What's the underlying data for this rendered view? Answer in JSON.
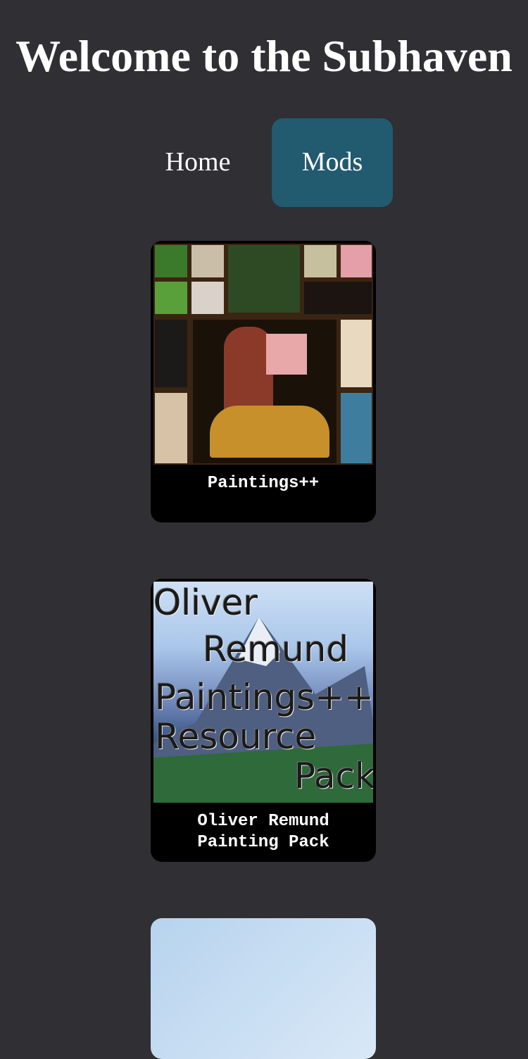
{
  "header": {
    "title": "Welcome to the Subhaven"
  },
  "nav": {
    "home_label": "Home",
    "mods_label": "Mods",
    "active": "Mods"
  },
  "mods": [
    {
      "name": "Paintings++"
    },
    {
      "name": "Oliver Remund Painting Pack",
      "name_line1": "Oliver Remund",
      "name_line2": "Painting Pack",
      "thumbnail_text": [
        "Oliver",
        "Remund",
        "Paintings++",
        "Resource",
        "Pack"
      ]
    }
  ],
  "colors": {
    "background": "#2f2f34",
    "active_nav": "#225a70",
    "card": "#000000"
  }
}
